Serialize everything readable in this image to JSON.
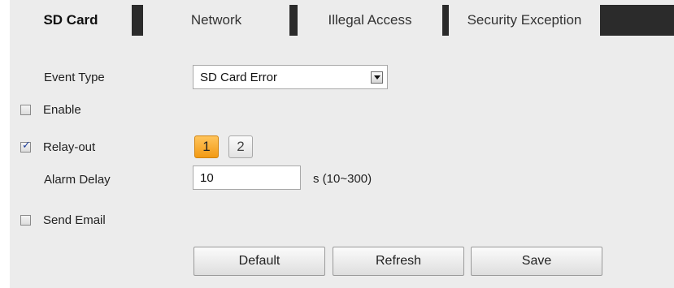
{
  "tabs": [
    {
      "label": "SD Card",
      "active": true
    },
    {
      "label": "Network",
      "active": false
    },
    {
      "label": "Illegal Access",
      "active": false
    },
    {
      "label": "Security Exception",
      "active": false
    }
  ],
  "form": {
    "event_type": {
      "label": "Event Type",
      "selected": "SD Card Error"
    },
    "enable": {
      "label": "Enable",
      "checked": false
    },
    "relay_out": {
      "label": "Relay-out",
      "checked": true,
      "buttons": [
        {
          "label": "1",
          "selected": true
        },
        {
          "label": "2",
          "selected": false
        }
      ]
    },
    "alarm_delay": {
      "label": "Alarm Delay",
      "value": "10",
      "unit": "s (10~300)"
    },
    "send_email": {
      "label": "Send Email",
      "checked": false
    }
  },
  "actions": {
    "default_label": "Default",
    "refresh_label": "Refresh",
    "save_label": "Save"
  },
  "colors": {
    "panel_bg": "#ececec",
    "tab_separator": "#2b2b2b",
    "relay_selected": "#f5a623",
    "checkmark": "#1f3f9a"
  }
}
